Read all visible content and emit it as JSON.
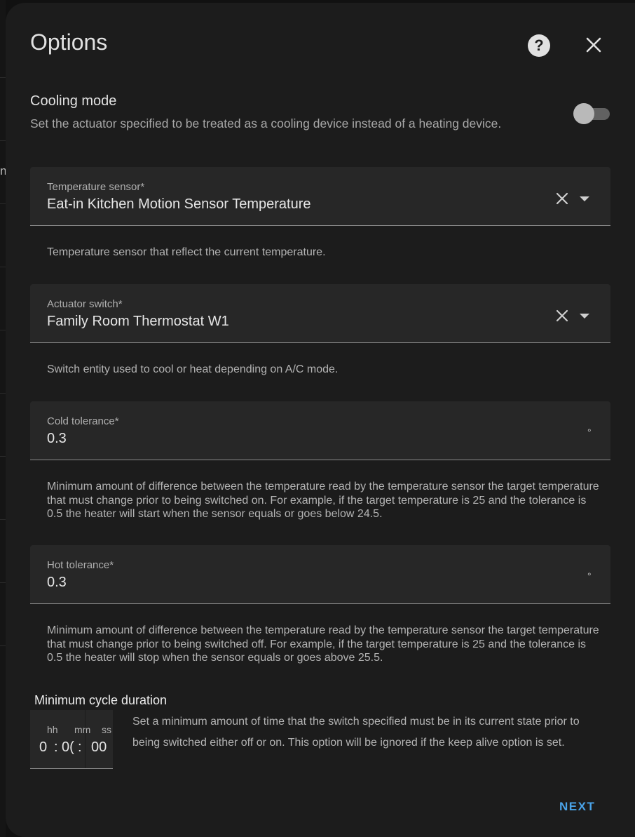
{
  "backdrop": {
    "edge_text": "n"
  },
  "dialog": {
    "title": "Options",
    "help_glyph": "?",
    "help_icon": "help-circle-icon",
    "close_icon": "close-icon"
  },
  "cooling": {
    "title": "Cooling mode",
    "description": "Set the actuator specified to be treated as a cooling device instead of a heating device.",
    "enabled": false
  },
  "fields": {
    "temperature_sensor": {
      "label": "Temperature sensor*",
      "value": "Eat-in Kitchen Motion Sensor Temperature",
      "helper": "Temperature sensor that reflect the current temperature."
    },
    "actuator_switch": {
      "label": "Actuator switch*",
      "value": "Family Room Thermostat W1",
      "helper": "Switch entity used to cool or heat depending on A/C mode."
    },
    "cold_tolerance": {
      "label": "Cold tolerance*",
      "value": "0.3",
      "unit": "°",
      "helper": "Minimum amount of difference between the temperature read by the temperature sensor the target temperature that must change prior to being switched on. For example, if the target temperature is 25 and the tolerance is 0.5 the heater will start when the sensor equals or goes below 24.5."
    },
    "hot_tolerance": {
      "label": "Hot tolerance*",
      "value": "0.3",
      "unit": "°",
      "helper": "Minimum amount of difference between the temperature read by the temperature sensor the target temperature that must change prior to being switched off. For example, if the target temperature is 25 and the tolerance is 0.5 the heater will stop when the sensor equals or goes above 25.5."
    }
  },
  "min_cycle": {
    "title": "Minimum cycle duration",
    "hh_label": "hh",
    "mm_label": "mm",
    "ss_label": "ss",
    "hh_value": "0",
    "mm_value": "0(",
    "ss_value": "00",
    "separator": ":",
    "description": "Set a minimum amount of time that the switch specified must be in its current state prior to being switched either off or on. This option will be ignored if the keep alive option is set."
  },
  "actions": {
    "next_label": "NEXT"
  },
  "colors": {
    "accent": "#4aa3e8",
    "surface": "#1c1c1c",
    "field": "#272727"
  }
}
